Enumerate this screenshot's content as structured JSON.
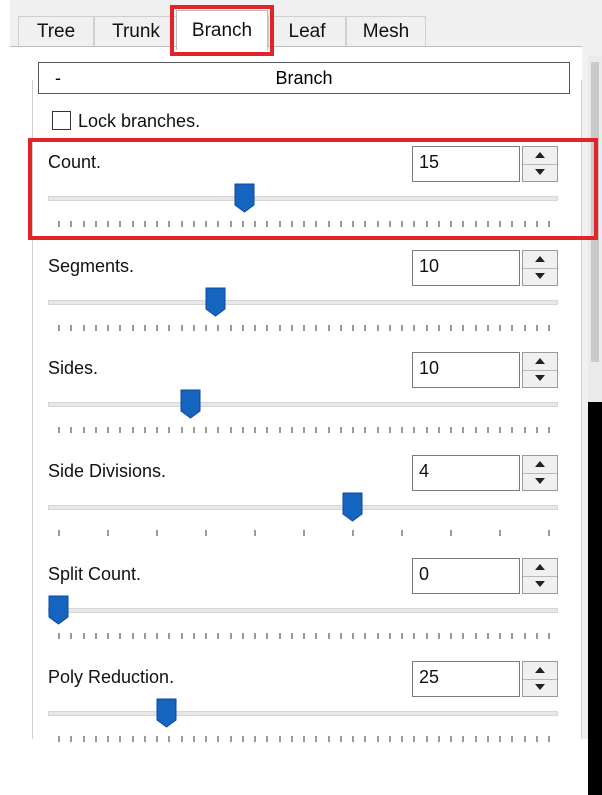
{
  "tabs": [
    {
      "label": "Tree",
      "active": false
    },
    {
      "label": "Trunk",
      "active": false
    },
    {
      "label": "Branch",
      "active": true
    },
    {
      "label": "Leaf",
      "active": false
    },
    {
      "label": "Mesh",
      "active": false
    }
  ],
  "group": {
    "toggle": "-",
    "title": "Branch"
  },
  "lock": {
    "label": "Lock branches.",
    "checked": false
  },
  "rows": [
    {
      "label": "Count.",
      "value": "15",
      "slider_fraction": 0.38
    },
    {
      "label": "Segments.",
      "value": "10",
      "slider_fraction": 0.32
    },
    {
      "label": "Sides.",
      "value": "10",
      "slider_fraction": 0.27
    },
    {
      "label": "Side Divisions.",
      "value": "4",
      "slider_fraction": 0.6
    },
    {
      "label": "Split Count.",
      "value": "0",
      "slider_fraction": 0.0
    },
    {
      "label": "Poly Reduction.",
      "value": "25",
      "slider_fraction": 0.22
    }
  ],
  "colors": {
    "thumb": "#1565c0",
    "highlight": "#e0242a"
  }
}
